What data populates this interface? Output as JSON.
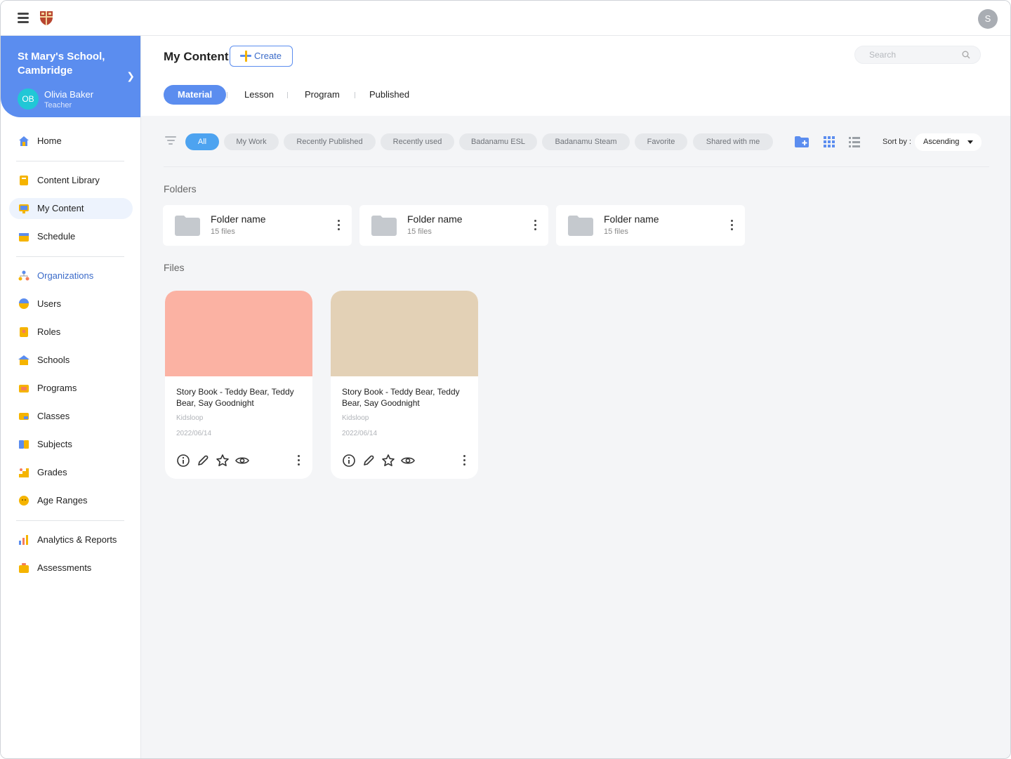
{
  "topbar": {
    "avatar_initial": "S"
  },
  "sidebar": {
    "org_name": "St Mary's School, Cambridge",
    "user_initials": "OB",
    "user_name": "Olivia Baker",
    "user_role": "Teacher",
    "items": [
      {
        "label": "Home",
        "icon": "house-icon"
      },
      {
        "label": "Content Library",
        "icon": "book-icon"
      },
      {
        "label": "My Content",
        "icon": "monitor-icon"
      },
      {
        "label": "Schedule",
        "icon": "calendar-icon"
      },
      {
        "label": "Organizations",
        "icon": "org-chart-icon"
      },
      {
        "label": "Users",
        "icon": "user-face-icon"
      },
      {
        "label": "Roles",
        "icon": "badge-icon"
      },
      {
        "label": "Schools",
        "icon": "school-icon"
      },
      {
        "label": "Programs",
        "icon": "program-icon"
      },
      {
        "label": "Classes",
        "icon": "class-icon"
      },
      {
        "label": "Subjects",
        "icon": "subject-icon"
      },
      {
        "label": "Grades",
        "icon": "grades-icon"
      },
      {
        "label": "Age Ranges",
        "icon": "age-icon"
      },
      {
        "label": "Analytics & Reports",
        "icon": "bar-chart-icon"
      },
      {
        "label": "Assessments",
        "icon": "briefcase-icon"
      }
    ]
  },
  "header": {
    "title": "My Content",
    "create_label": "Create",
    "search_placeholder": "Search",
    "tabs": [
      "Material",
      "Lesson",
      "Program",
      "Published"
    ]
  },
  "filters": {
    "chips": [
      "All",
      "My Work",
      "Recently Published",
      "Recently used",
      "Badanamu ESL",
      "Badanamu Steam",
      "Favorite",
      "Shared with me"
    ],
    "sort_label": "Sort by :",
    "sort_value": "Ascending"
  },
  "folders_label": "Folders",
  "folders": [
    {
      "name": "Folder name",
      "count": "15 files"
    },
    {
      "name": "Folder name",
      "count": "15 files"
    },
    {
      "name": "Folder name",
      "count": "15 files"
    }
  ],
  "files_label": "Files",
  "files": [
    {
      "title": "Story Book - Teddy Bear, Teddy Bear, Say Goodnight",
      "author": "Kidsloop",
      "date": "2022/06/14",
      "thumb_color": "#fbb2a3"
    },
    {
      "title": "Story Book - Teddy Bear, Teddy Bear, Say Goodnight",
      "author": "Kidsloop",
      "date": "2022/06/14",
      "thumb_color": "#e3d1b6"
    }
  ],
  "colors": {
    "accent": "#5b8def",
    "chip_active": "#4da3f0"
  }
}
